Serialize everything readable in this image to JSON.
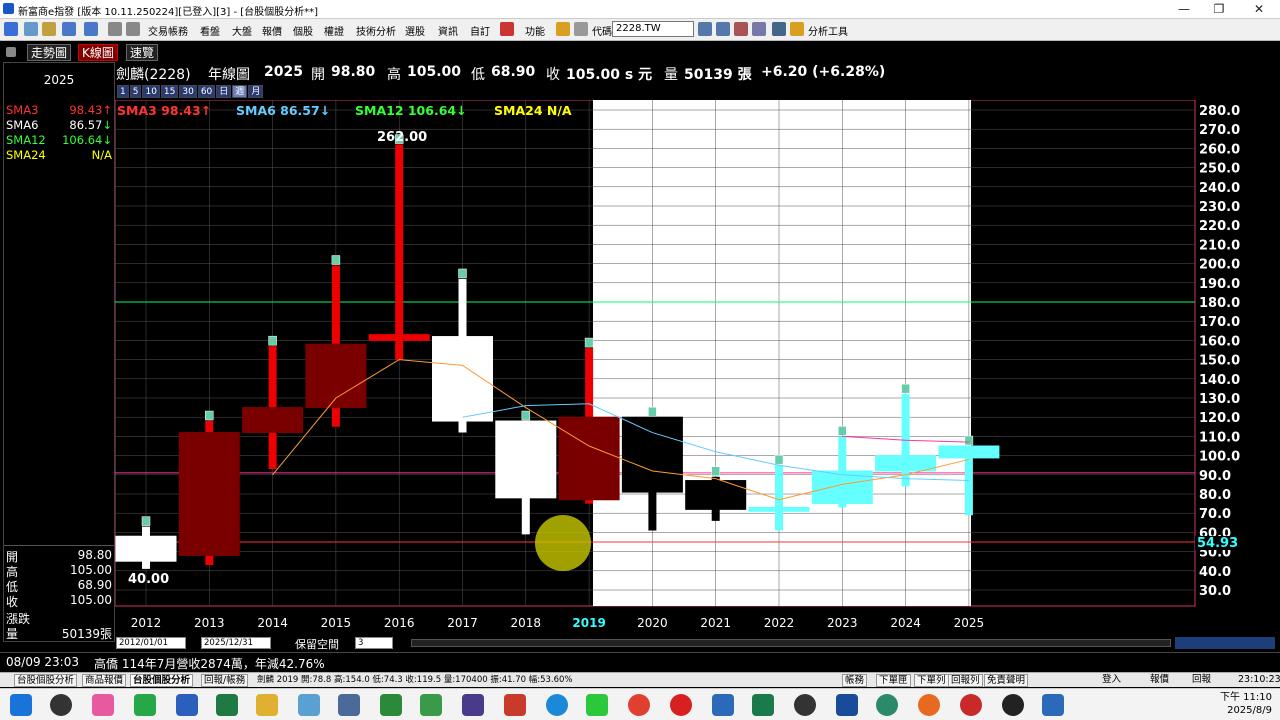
{
  "window": {
    "title": "新富商e指發 [版本 10.11.250224][已登入][3] - [台股個股分析**]"
  },
  "toolbar": {
    "menus": [
      "交易帳務",
      "看盤",
      "大盤",
      "報價",
      "個股",
      "權證",
      "技術分析",
      "選股",
      "資訊",
      "自訂",
      "功能",
      "代碼",
      "分析工具"
    ],
    "code_value": "2228.TW"
  },
  "tabs": [
    "走勢圖",
    "K線圖",
    "速覽"
  ],
  "left_panel": {
    "year": "2025",
    "sma": [
      {
        "label": "SMA3",
        "value": "98.43",
        "arrow": "↑",
        "color": "#ff3333"
      },
      {
        "label": "SMA6",
        "value": "86.57",
        "arrow": "↓",
        "color": "#ffffff"
      },
      {
        "label": "SMA12",
        "value": "106.64",
        "arrow": "↓",
        "color": "#33ff33"
      },
      {
        "label": "SMA24",
        "value": "N/A",
        "arrow": "",
        "color": "#ffff00"
      }
    ],
    "ohlc": [
      {
        "label": "開",
        "value": "98.80"
      },
      {
        "label": "高",
        "value": "105.00"
      },
      {
        "label": "低",
        "value": "68.90"
      },
      {
        "label": "收",
        "value": "105.00"
      }
    ],
    "change_label": "漲跌",
    "volume_label": "量",
    "volume_value": "50139張"
  },
  "header": {
    "stock": "劍麟(2228)",
    "period": "年線圖",
    "year": "2025",
    "open_label": "開",
    "open": "98.80",
    "high_label": "高",
    "high": "105.00",
    "low_label": "低",
    "low": "68.90",
    "close_label": "收",
    "close": "105.00 s 元",
    "vol_label": "量",
    "vol": "50139 張",
    "change": "+6.20 (+6.28%)"
  },
  "period_buttons": [
    "1",
    "5",
    "10",
    "15",
    "30",
    "60",
    "日",
    "週",
    "月"
  ],
  "sma_legend": [
    {
      "text": "SMA3 98.43↑",
      "color": "#ff3333"
    },
    {
      "text": "SMA6 86.57↓",
      "color": "#66ccff"
    },
    {
      "text": "SMA12 106.64↓",
      "color": "#33ff33"
    },
    {
      "text": "SMA24 N/A",
      "color": "#ffff00"
    }
  ],
  "chart_data": {
    "type": "candlestick",
    "x": [
      "2012",
      "2013",
      "2014",
      "2015",
      "2016",
      "2017",
      "2018",
      "2019",
      "2020",
      "2021",
      "2022",
      "2023",
      "2024",
      "2025"
    ],
    "candles": [
      {
        "year": "2012",
        "open": 45,
        "high": 63,
        "low": 41,
        "close": 58,
        "color": "white"
      },
      {
        "year": "2013",
        "open": 48,
        "high": 118,
        "low": 43,
        "close": 112,
        "color": "darkred"
      },
      {
        "year": "2014",
        "open": 112,
        "high": 157,
        "low": 93,
        "close": 125,
        "color": "darkred"
      },
      {
        "year": "2015",
        "open": 125,
        "high": 199,
        "low": 115,
        "close": 158,
        "color": "darkred"
      },
      {
        "year": "2016",
        "open": 160,
        "high": 262,
        "low": 150,
        "close": 163,
        "color": "red"
      },
      {
        "year": "2017",
        "open": 162,
        "high": 192,
        "low": 112,
        "close": 118,
        "color": "white"
      },
      {
        "year": "2018",
        "open": 118,
        "high": 118,
        "low": 59,
        "close": 78,
        "color": "white"
      },
      {
        "year": "2019",
        "open": 77,
        "high": 156,
        "low": 75,
        "close": 120,
        "color": "darkred"
      },
      {
        "year": "2020",
        "open": 120,
        "high": 120,
        "low": 61,
        "close": 81,
        "color": "black"
      },
      {
        "year": "2021",
        "open": 87,
        "high": 89,
        "low": 66,
        "close": 72,
        "color": "black"
      },
      {
        "year": "2022",
        "open": 71,
        "high": 95,
        "low": 61,
        "close": 73,
        "color": "cyan"
      },
      {
        "year": "2023",
        "open": 75,
        "high": 110,
        "low": 73,
        "close": 92,
        "color": "cyan"
      },
      {
        "year": "2024",
        "open": 92,
        "high": 132,
        "low": 84,
        "close": 100,
        "color": "cyan"
      },
      {
        "year": "2025",
        "open": 98.8,
        "high": 105,
        "low": 68.9,
        "close": 105,
        "color": "cyan"
      }
    ],
    "labels": {
      "max": "262.00",
      "min": "40.00",
      "last_right": "54.93"
    },
    "yticks": [
      "280.0",
      "270.0",
      "260.0",
      "250.0",
      "240.0",
      "230.0",
      "220.0",
      "210.0",
      "200.0",
      "190.0",
      "180.0",
      "170.0",
      "160.0",
      "150.0",
      "140.0",
      "130.0",
      "120.0",
      "110.0",
      "100.0",
      "90.0",
      "80.0",
      "70.0",
      "60.0",
      "50.0",
      "40.0",
      "30.0"
    ],
    "ylim": [
      30,
      280
    ],
    "sma3": [
      null,
      null,
      90,
      130,
      150,
      147,
      125,
      105,
      92,
      88,
      77,
      85,
      90,
      98
    ],
    "sma6": [
      null,
      null,
      null,
      null,
      null,
      120,
      126,
      127,
      112,
      102,
      95,
      90,
      88,
      87
    ],
    "sma12": [
      null,
      null,
      null,
      null,
      null,
      null,
      null,
      null,
      null,
      null,
      null,
      110,
      108,
      107
    ],
    "hlines": [
      {
        "value": 180,
        "color": "#00ff66"
      },
      {
        "value": 91,
        "color": "#ff3399"
      },
      {
        "value": 55,
        "color": "#ff3333"
      }
    ]
  },
  "bottom_controls": {
    "start_date": "2012/01/01",
    "end_date": "2025/12/31",
    "keep_space_label": "保留空間",
    "keep_space_value": "3"
  },
  "status": {
    "datetime": "08/09 23:03",
    "news": "高僑 114年7月營收2874萬，年減42.76%"
  },
  "bottom_tabs": [
    "台股個股分析",
    "商品報價",
    "台股個股分析",
    "回報/帳務",
    "劍麟 2019 開:78.8 高:154.0 低:74.3 收:119.5 量:170400 振:41.70 幅:53.60%",
    "帳務",
    "下單匣",
    "下單列",
    "回報列",
    "免責聲明",
    "登入",
    "報價",
    "回報",
    "23:10:23"
  ],
  "taskbar": {
    "time": "下午 11:10",
    "date": "2025/8/9"
  }
}
